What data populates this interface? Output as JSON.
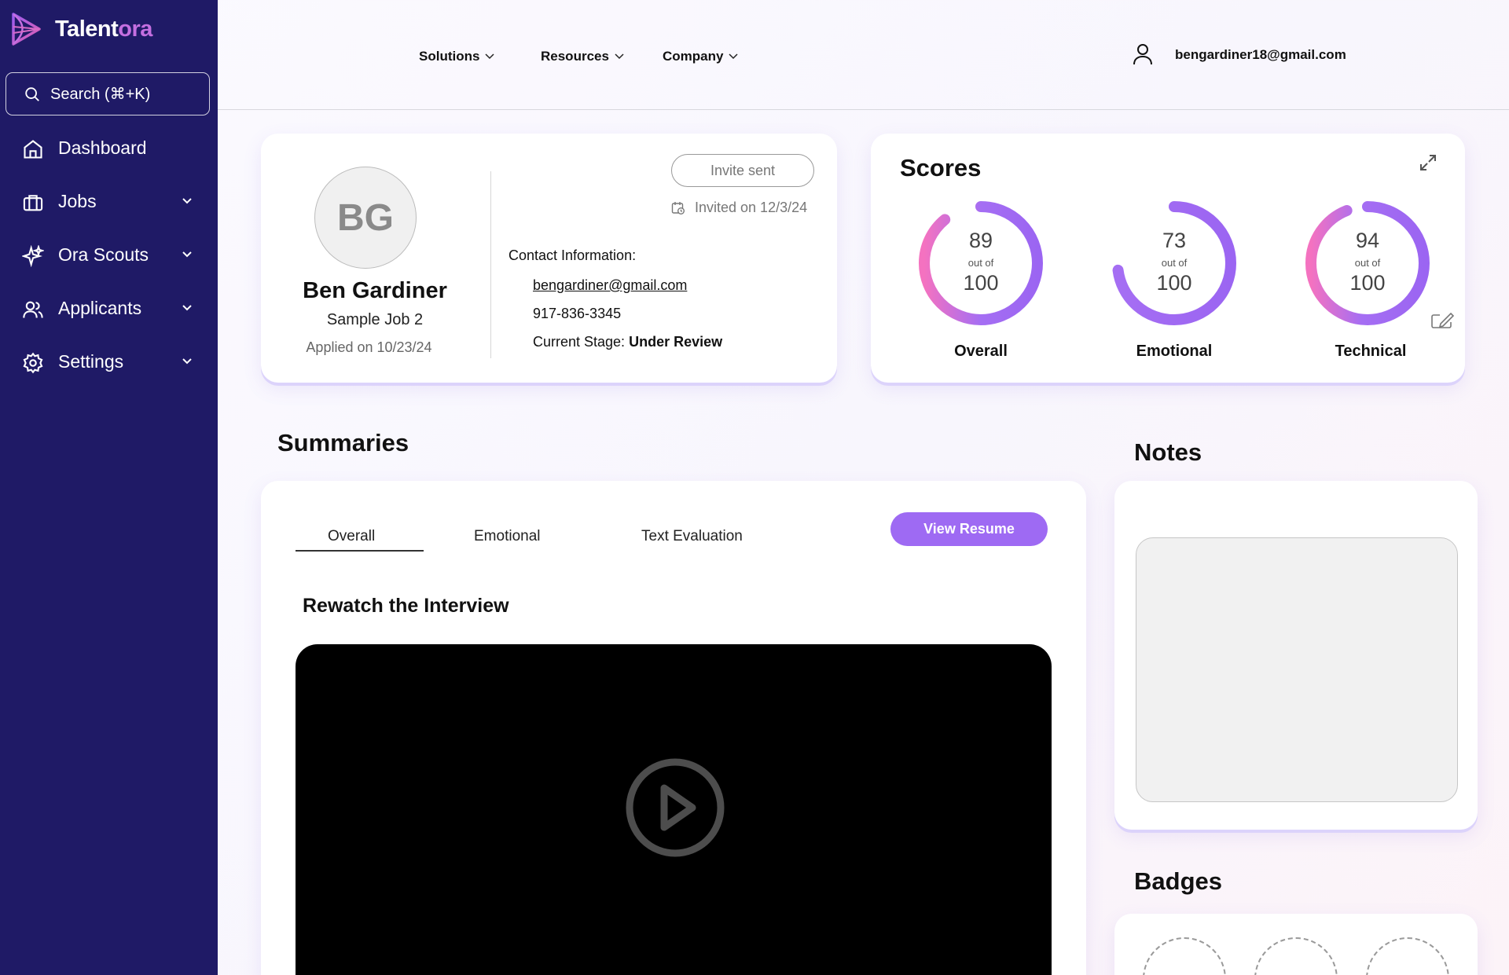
{
  "app": {
    "name_part1": "Talent",
    "name_part2": "ora",
    "brand_color": "#1f1a66",
    "accent_color": "#9e6af3"
  },
  "sidebar": {
    "search_label": "Search (⌘+K)",
    "items": [
      {
        "label": "Dashboard",
        "icon": "home-icon",
        "has_chevron": false
      },
      {
        "label": "Jobs",
        "icon": "briefcase-icon",
        "has_chevron": true
      },
      {
        "label": "Ora Scouts",
        "icon": "sparkles-icon",
        "has_chevron": true
      },
      {
        "label": "Applicants",
        "icon": "users-icon",
        "has_chevron": true
      },
      {
        "label": "Settings",
        "icon": "gear-icon",
        "has_chevron": true
      }
    ]
  },
  "header": {
    "menu": [
      "Solutions",
      "Resources",
      "Company"
    ],
    "user_email": "bengardiner18@gmail.com"
  },
  "candidate": {
    "initials": "BG",
    "name": "Ben Gardiner",
    "job": "Sample Job 2",
    "applied": "Applied on 10/23/24",
    "invite_button": "Invite sent",
    "invited_on": "Invited on 12/3/24",
    "contact_title": "Contact Information:",
    "email": "bengardiner@gmail.com",
    "phone": "917-836-3345",
    "stage_label": "Current Stage:",
    "stage_value": "Under Review"
  },
  "scores": {
    "title": "Scores",
    "out_of_label": "out of",
    "max": "100",
    "items": [
      {
        "label": "Overall",
        "value": 89
      },
      {
        "label": "Emotional",
        "value": 73
      },
      {
        "label": "Technical",
        "value": 94
      }
    ]
  },
  "summaries": {
    "title": "Summaries",
    "tabs": [
      "Overall",
      "Emotional",
      "Text Evaluation"
    ],
    "active_tab": "Overall",
    "view_resume_button": "View Resume",
    "rewatch_title": "Rewatch the Interview"
  },
  "notes": {
    "title": "Notes"
  },
  "badges": {
    "title": "Badges",
    "empty_slots": 3
  }
}
